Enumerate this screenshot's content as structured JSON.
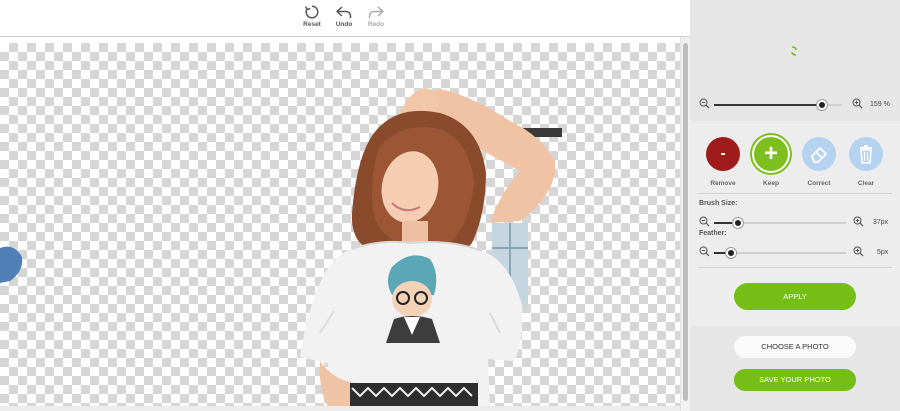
{
  "toolbar": {
    "reset_label": "Reset",
    "undo_label": "Undo",
    "redo_label": "Redo"
  },
  "zoom": {
    "value_label": "159 %",
    "level_fraction": 0.84
  },
  "brush_modes": {
    "remove": {
      "label": "Remove",
      "symbol": "-"
    },
    "keep": {
      "label": "Keep",
      "symbol": "+"
    },
    "correct": {
      "label": "Correct"
    },
    "clear": {
      "label": "Clear"
    }
  },
  "brush": {
    "size_label": "Brush Size:",
    "size_value": "37px",
    "size_fraction": 0.18,
    "feather_label": "Feather:",
    "feather_value": "5px",
    "feather_fraction": 0.13
  },
  "actions": {
    "apply_label": "APPLY",
    "choose_label": "CHOOSE A PHOTO",
    "save_label": "SAVE YOUR PHOTO"
  },
  "colors": {
    "accent_green": "#74be15",
    "remove_red": "#a01c1c",
    "tool_blue": "#b6d2f1",
    "panel_bg": "#e6e6e6"
  },
  "icons": [
    "reset-icon",
    "undo-icon",
    "redo-icon",
    "spinner-icon",
    "zoom-out-icon",
    "zoom-in-icon",
    "minus-icon",
    "plus-icon",
    "eraser-icon",
    "trash-icon"
  ]
}
